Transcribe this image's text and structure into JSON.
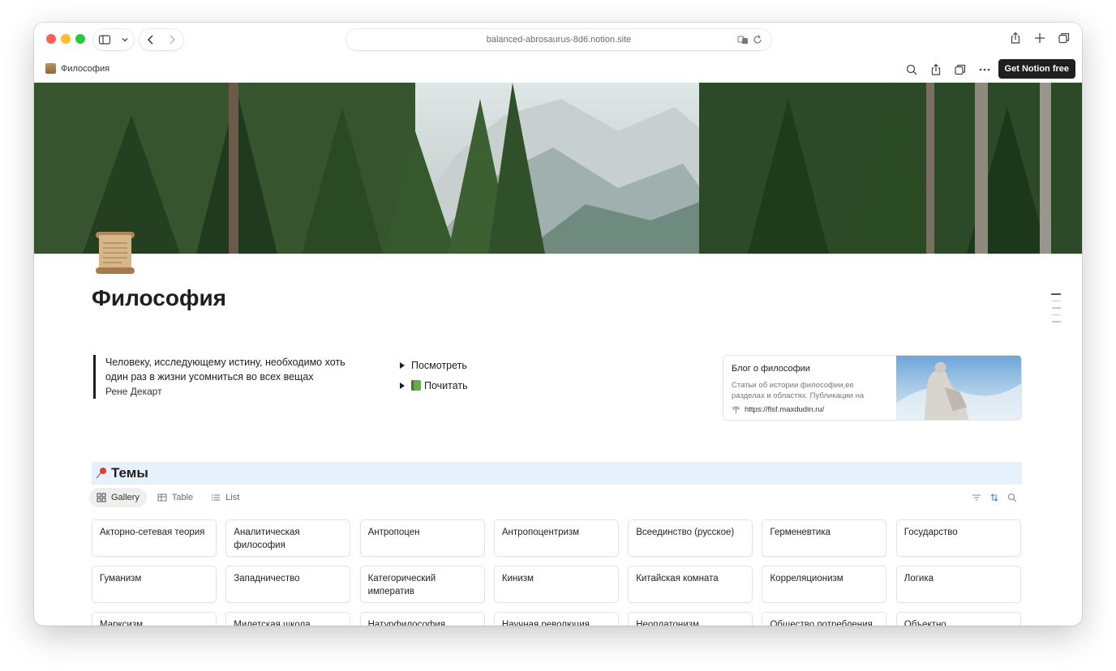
{
  "browser": {
    "url": "balanced-abrosaurus-8d6.notion.site"
  },
  "notion_bar": {
    "breadcrumb": "Философия",
    "cta_label": "Get Notion free"
  },
  "page": {
    "title": "Философия",
    "quote": {
      "text": "Человеку, исследующему истину, необходимо хоть один раз в жизни усомниться во всех вещах",
      "author": "Рене Декарт"
    },
    "toggles": [
      {
        "label": "Посмотреть"
      },
      {
        "label": "Почитать"
      }
    ],
    "bookmark": {
      "title": "Блог о философии",
      "description": "Статьи об истории философии,ее разделах и областях. Публикации на",
      "url": "https://flsf.maxdudin.ru/"
    },
    "section_heading": "Темы",
    "views": [
      {
        "label": "Gallery",
        "icon": "gallery-icon",
        "active": true
      },
      {
        "label": "Table",
        "icon": "table-icon",
        "active": false
      },
      {
        "label": "List",
        "icon": "list-icon",
        "active": false
      }
    ],
    "cards": [
      "Акторно-сетевая теория",
      "Аналитическая философия",
      "Антропоцен",
      "Антропоцентризм",
      "Всеединство (русское)",
      "Герменевтика",
      "Государство",
      "Гуманизм",
      "Западничество",
      "Категорический императив",
      "Кинизм",
      "Китайская комната",
      "Корреляционизм",
      "Логика",
      "Марксизм",
      "Милетская школа",
      "Натурфилософия",
      "Научная революция",
      "Неоплатонизм",
      "Общество потребления",
      "Объектно"
    ]
  }
}
